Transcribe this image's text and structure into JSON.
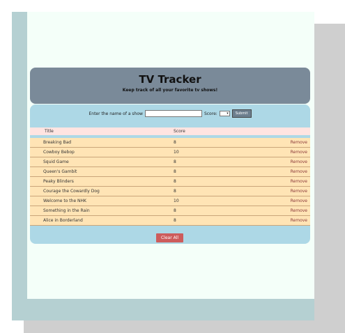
{
  "header": {
    "title": "TV Tracker",
    "subtitle": "Keep track of all your favorite tv shows!"
  },
  "form": {
    "prompt": "Enter the name of a show",
    "show_placeholder": "",
    "score_label": "Score:",
    "score_value": "",
    "submit_label": "Submit"
  },
  "table": {
    "headers": {
      "title": "Title",
      "score": "Score"
    },
    "rows": [
      {
        "title": "Breaking Bad",
        "score": "8",
        "action": "Remove"
      },
      {
        "title": "Cowboy Bebop",
        "score": "10",
        "action": "Remove"
      },
      {
        "title": "Squid Game",
        "score": "8",
        "action": "Remove"
      },
      {
        "title": "Queen's Gambit",
        "score": "8",
        "action": "Remove"
      },
      {
        "title": "Peaky Blinders",
        "score": "8",
        "action": "Remove"
      },
      {
        "title": "Courage the Cowardly Dog",
        "score": "8",
        "action": "Remove"
      },
      {
        "title": "Welcome to the NHK",
        "score": "10",
        "action": "Remove"
      },
      {
        "title": "Something in the Rain",
        "score": "8",
        "action": "Remove"
      },
      {
        "title": "Alice in Borderland",
        "score": "8",
        "action": "Remove"
      }
    ]
  },
  "clear_label": "Clear All"
}
